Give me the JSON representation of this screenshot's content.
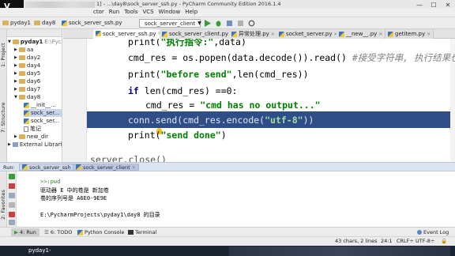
{
  "window": {
    "title_text": "1] - ...\\day8\\sock_server_ssh.py - PyCharm Community Edition 2016.1.4",
    "logo_text": "V",
    "buttons": {
      "minimize": "—",
      "maximize": "☐",
      "close": "✕"
    }
  },
  "menu": [
    "ctor",
    "Run",
    "Tools",
    "VCS",
    "Window",
    "Help"
  ],
  "navbar": {
    "breadcrumbs": [
      "pyday1",
      "day8",
      "sock_server_ssh.py"
    ],
    "run_config": "sock_server_client"
  },
  "project_panel": {
    "label": "Project",
    "root": "pyday1",
    "root_path": "E:\\Pyc",
    "items": [
      "aa",
      "day2",
      "day4",
      "day5",
      "day6",
      "day7",
      "day8",
      "__init__...",
      "sock_ser...",
      "sock_ser...",
      "笔记",
      "new_dir",
      "External Librari"
    ]
  },
  "side_tabs": {
    "project": "1: Project",
    "structure": "7: Structure",
    "favorites": "2: Favorites"
  },
  "tabs": [
    {
      "label": "sock_server_ssh.py",
      "active": true
    },
    {
      "label": "sock_server_client.py",
      "active": false
    },
    {
      "label": "异常处理.py",
      "active": false
    },
    {
      "label": "socket_server.py",
      "active": false
    },
    {
      "label": "__new__.py",
      "active": false
    },
    {
      "label": "getitem.py",
      "active": false
    }
  ],
  "code": {
    "line1": {
      "a": "print(",
      "s": "\"执行指令:\"",
      "b": ",data)"
    },
    "line2": {
      "a": "cmd_res = os.popen(data.decode()).read() ",
      "c": "#接受字符串, 执行结果也是字符串"
    },
    "line3": {
      "a": "print(",
      "s": "\"before send\"",
      "b": ",len(cmd_res))"
    },
    "line4": {
      "k": "if",
      "a": " len(cmd_res) ==0:"
    },
    "line5": {
      "a": "cmd_res = ",
      "s": "\"cmd has no output...\""
    },
    "line6": {
      "a": "conn.send(cmd_res.encode(",
      "s": "\"utf-8\"",
      "b": "))"
    },
    "line7": {
      "a": "print(",
      "s": "\"send done\"",
      "b": ")"
    },
    "line8": {
      "a": "server.close()"
    }
  },
  "run_panel": {
    "label": "Run:",
    "tabs": [
      "sock_server_ssh",
      "sock_server_client"
    ]
  },
  "console": {
    "lines": [
      ">>:pwd",
      "驱动器 E 中的卷是 新加卷",
      "卷的序列号是 A6E0-9E9E",
      "",
      "E:\\PycharmProjects\\pyday1\\day8 的目录"
    ]
  },
  "bottom_tabs": [
    "4: Run",
    "6: TODO",
    "Python Console",
    "Terminal",
    "Event Log"
  ],
  "status": {
    "selection": "43 chars, 2 lines",
    "position": "24:1",
    "line_sep": "CRLF÷",
    "encoding": "UTF-8÷"
  },
  "taskbar": {
    "label": "pyday1-"
  }
}
